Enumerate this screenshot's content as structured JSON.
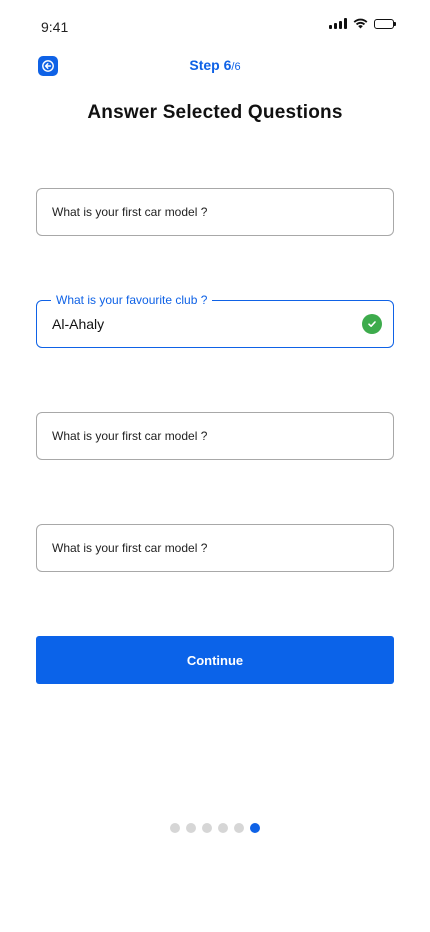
{
  "status_bar": {
    "time": "9:41"
  },
  "header": {
    "step_label": "Step ",
    "step_current": "6",
    "step_total": "/6",
    "title": "Answer Selected Questions"
  },
  "fields": [
    {
      "placeholder": "What is your first car model ?",
      "value": ""
    },
    {
      "label": "What is your favourite club ?",
      "value": "Al-Ahaly",
      "status": "valid"
    },
    {
      "placeholder": "What is your first car model ?",
      "value": ""
    },
    {
      "placeholder": "What is your first car model ?",
      "value": ""
    }
  ],
  "continue_label": "Continue",
  "pagination": {
    "total_steps": 6,
    "current_step": 6
  },
  "colors": {
    "accent": "#0f62e6",
    "success": "#3dab4c",
    "dot_inactive": "#d6d6d6"
  },
  "icons": {
    "back": "arrow-left-icon",
    "valid": "check-circle-icon",
    "signal": "cellular-signal-icon",
    "wifi": "wifi-icon",
    "battery": "battery-icon"
  }
}
